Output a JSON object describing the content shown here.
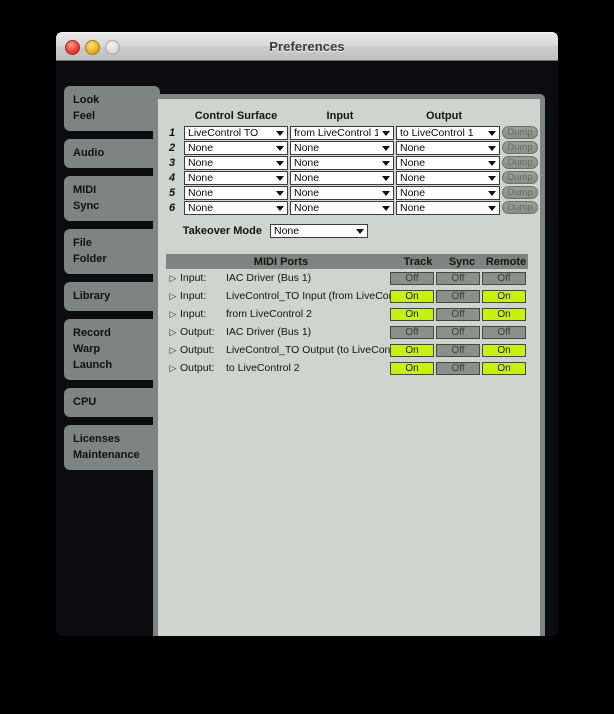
{
  "window": {
    "title": "Preferences",
    "controls": [
      "close-button",
      "minimize-button",
      "zoom-button"
    ]
  },
  "sidebar": {
    "items": [
      {
        "lines": [
          "Look",
          "Feel"
        ],
        "selected": false
      },
      {
        "lines": [
          "Audio"
        ],
        "selected": false
      },
      {
        "lines": [
          "MIDI",
          "Sync"
        ],
        "selected": true
      },
      {
        "lines": [
          "File",
          "Folder"
        ],
        "selected": false
      },
      {
        "lines": [
          "Library"
        ],
        "selected": false
      },
      {
        "lines": [
          "Record",
          "Warp",
          "Launch"
        ],
        "selected": false
      },
      {
        "lines": [
          "CPU"
        ],
        "selected": false
      },
      {
        "lines": [
          "Licenses",
          "Maintenance"
        ],
        "selected": false
      }
    ]
  },
  "control_surfaces": {
    "headers": [
      "Control Surface",
      "Input",
      "Output"
    ],
    "dump_label": "Dump",
    "rows": [
      {
        "num": "1",
        "surface": "LiveControl TO",
        "input": "from LiveControl 1",
        "output": "to LiveControl 1"
      },
      {
        "num": "2",
        "surface": "None",
        "input": "None",
        "output": "None"
      },
      {
        "num": "3",
        "surface": "None",
        "input": "None",
        "output": "None"
      },
      {
        "num": "4",
        "surface": "None",
        "input": "None",
        "output": "None"
      },
      {
        "num": "5",
        "surface": "None",
        "input": "None",
        "output": "None"
      },
      {
        "num": "6",
        "surface": "None",
        "input": "None",
        "output": "None"
      }
    ]
  },
  "takeover": {
    "label": "Takeover Mode",
    "value": "None"
  },
  "midi_ports": {
    "headers": {
      "ports": "MIDI Ports",
      "track": "Track",
      "sync": "Sync",
      "remote": "Remote"
    },
    "rows": [
      {
        "kind": "Input:",
        "name": "IAC Driver (Bus 1)",
        "track": "Off",
        "sync": "Off",
        "remote": "Off"
      },
      {
        "kind": "Input:",
        "name": "LiveControl_TO Input (from LiveContr",
        "track": "On",
        "sync": "Off",
        "remote": "On"
      },
      {
        "kind": "Input:",
        "name": "from LiveControl 2",
        "track": "On",
        "sync": "Off",
        "remote": "On"
      },
      {
        "kind": "Output:",
        "name": "IAC Driver (Bus 1)",
        "track": "Off",
        "sync": "Off",
        "remote": "Off"
      },
      {
        "kind": "Output:",
        "name": "LiveControl_TO Output (to LiveContr",
        "track": "On",
        "sync": "Off",
        "remote": "On"
      },
      {
        "kind": "Output:",
        "name": "to LiveControl 2",
        "track": "On",
        "sync": "Off",
        "remote": "On"
      }
    ]
  },
  "icons": {
    "disclosure": "▷",
    "dropdown_arrow": "dropdown-triangle-icon"
  },
  "colors": {
    "on": "#c6f211",
    "off": "#8b918a",
    "panel": "#ced4d0",
    "frame": "#7d8582",
    "window_body": "#0c0c10"
  }
}
